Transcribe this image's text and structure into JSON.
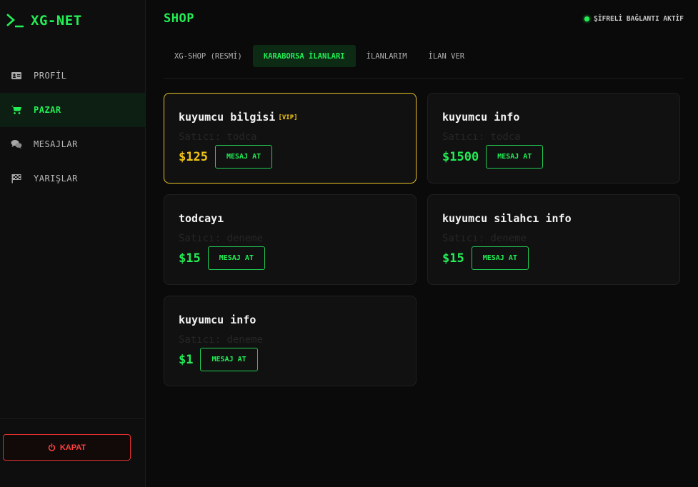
{
  "brand": {
    "name": "XG-NET",
    "icon": "terminal-prompt-icon"
  },
  "nav": [
    {
      "label": "PROFİL",
      "icon": "id-card-icon",
      "active": false
    },
    {
      "label": "PAZAR",
      "icon": "shopping-cart-icon",
      "active": true
    },
    {
      "label": "MESAJLAR",
      "icon": "chat-bubbles-icon",
      "active": false
    },
    {
      "label": "YARIŞLAR",
      "icon": "checkered-flag-icon",
      "active": false
    }
  ],
  "close_button": {
    "label": "KAPAT",
    "icon": "power-icon"
  },
  "header": {
    "title": "SHOP",
    "status": "ŞİFRELİ BAĞLANTI AKTİF"
  },
  "tabs": [
    {
      "label": "XG-SHOP (RESMİ)",
      "active": false
    },
    {
      "label": "KARABORSA İLANLARI",
      "active": true
    },
    {
      "label": "İLANLARIM",
      "active": false
    },
    {
      "label": "İLAN VER",
      "active": false
    }
  ],
  "listings": [
    {
      "title": "kuyumcu bilgisi",
      "badge": "[VIP]",
      "seller": "Satıcı: todca",
      "price": "$125",
      "button": "MESAJ AT",
      "vip": true
    },
    {
      "title": "kuyumcu info",
      "badge": "",
      "seller": "Satıcı: todca",
      "price": "$1500",
      "button": "MESAJ AT",
      "vip": false
    },
    {
      "title": "todcayı",
      "badge": "",
      "seller": "Satıcı: deneme",
      "price": "$15",
      "button": "MESAJ AT",
      "vip": false
    },
    {
      "title": "kuyumcu silahcı info",
      "badge": "",
      "seller": "Satıcı: deneme",
      "price": "$15",
      "button": "MESAJ AT",
      "vip": false
    },
    {
      "title": "kuyumcu info",
      "badge": "",
      "seller": "Satıcı: deneme",
      "price": "$1",
      "button": "MESAJ AT",
      "vip": false
    }
  ],
  "colors": {
    "accent": "#22ee55",
    "vip": "#f2c416",
    "danger": "#ff4040",
    "background": "#0a0a0a"
  }
}
